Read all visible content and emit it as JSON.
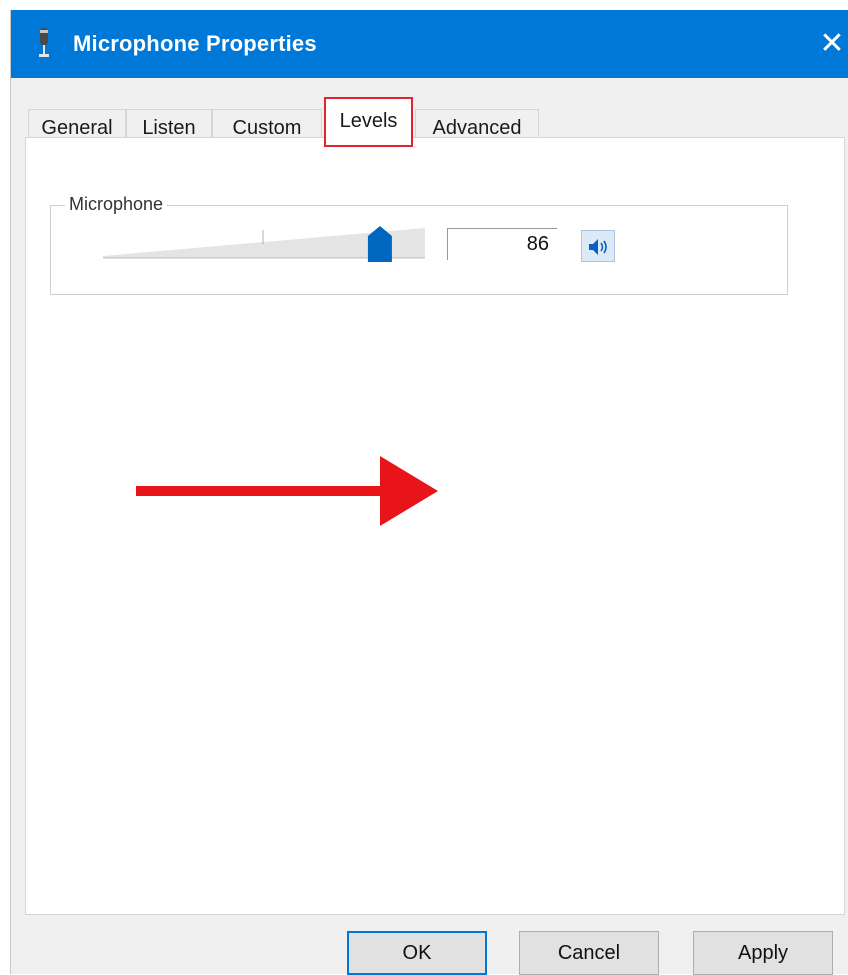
{
  "window": {
    "title": "Microphone Properties",
    "close_glyph": "✕",
    "accent_color": "#0078d7"
  },
  "tabs": [
    {
      "label": "General",
      "active": false
    },
    {
      "label": "Listen",
      "active": false
    },
    {
      "label": "Custom",
      "active": false
    },
    {
      "label": "Levels",
      "active": true
    },
    {
      "label": "Advanced",
      "active": false
    }
  ],
  "levels": {
    "group_label": "Microphone",
    "level_value": "86",
    "slider_fraction": 0.86,
    "mute_icon": "speaker-icon"
  },
  "annotation": {
    "color": "#e8141a",
    "highlight_tab": "Levels"
  },
  "buttons": {
    "ok": "OK",
    "cancel": "Cancel",
    "apply": "Apply"
  }
}
